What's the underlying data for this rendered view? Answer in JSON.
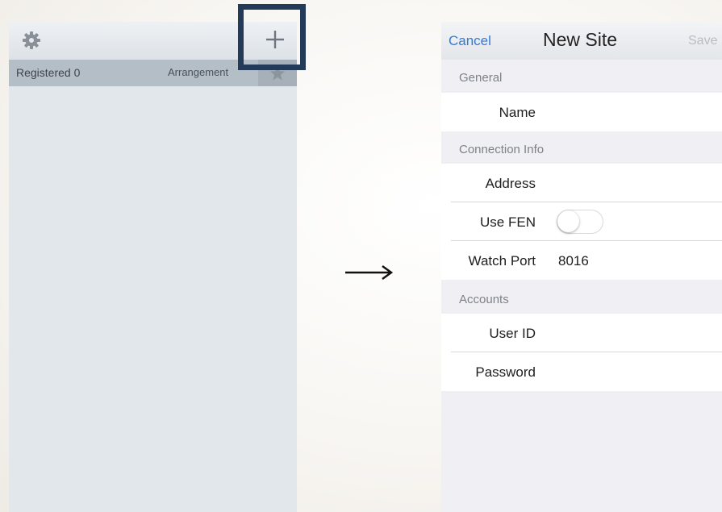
{
  "left": {
    "toolbar": {
      "settings_icon": "gear-icon",
      "add_icon": "plus-icon"
    },
    "list_header": {
      "registered": "Registered 0",
      "arrangement": "Arrangement",
      "favorites_icon": "star-icon"
    }
  },
  "annotation": {
    "highlight_color": "#233a59",
    "arrow_icon": "right-arrow-icon"
  },
  "right": {
    "nav": {
      "cancel": "Cancel",
      "title": "New Site",
      "save": "Save"
    },
    "sections": {
      "general": "General",
      "connection": "Connection Info",
      "accounts": "Accounts"
    },
    "fields": {
      "name": {
        "label": "Name",
        "value": ""
      },
      "address": {
        "label": "Address",
        "value": ""
      },
      "use_fen": {
        "label": "Use FEN",
        "on": false
      },
      "watch_port": {
        "label": "Watch Port",
        "value": "8016"
      },
      "user_id": {
        "label": "User ID",
        "value": ""
      },
      "password": {
        "label": "Password",
        "value": ""
      }
    },
    "colors": {
      "accent": "#2f7bd8",
      "disabled": "#b8bcc2"
    }
  }
}
